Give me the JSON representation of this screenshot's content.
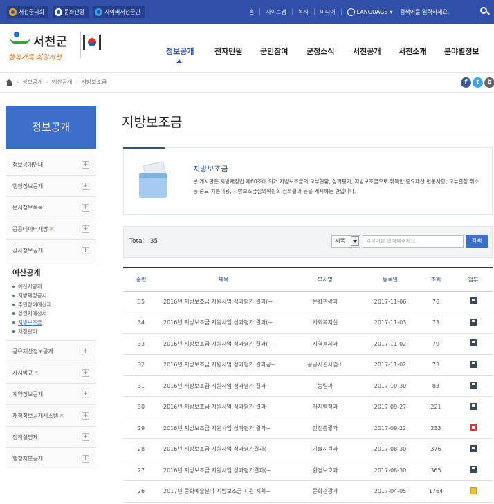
{
  "topbar": {
    "buttons": [
      "서천군의회",
      "문화관광",
      "사이버서천군민"
    ],
    "links": [
      "홈",
      "사이트맵",
      "복지",
      "미디어"
    ],
    "language": "LANGUAGE",
    "search_placeholder": "검색어를 입력하세요."
  },
  "header": {
    "logo_name": "서천군",
    "slogan": "행복가득 희망서천",
    "gnb": [
      "정보공개",
      "전자민원",
      "군민참여",
      "군정소식",
      "서천공개",
      "서천소개",
      "분야별정보"
    ]
  },
  "breadcrumb": [
    "정보공개",
    "예산공개",
    "지방보조금"
  ],
  "sidebar": {
    "title": "정보공개",
    "items_top": [
      {
        "label": "정보공개안내"
      },
      {
        "label": "행정정보공개"
      },
      {
        "label": "문서정보목록"
      },
      {
        "label": "공공데이터개방",
        "mini": "⇱"
      },
      {
        "label": "감사정보공개"
      }
    ],
    "open_group": {
      "label": "예산공개",
      "subs": [
        "예산서공개",
        "지방재정공시",
        "주민참여예산제",
        "성인지예산서",
        "지방보조금",
        "재정관리"
      ],
      "active_index": 4
    },
    "items_bottom": [
      {
        "label": "공유재산정보공개"
      },
      {
        "label": "자치법규",
        "mini": "⇱"
      },
      {
        "label": "계약정보공개"
      },
      {
        "label": "재정정보공개시스템",
        "mini": "⇱"
      },
      {
        "label": "정책실명제"
      },
      {
        "label": "행정처분공개"
      }
    ]
  },
  "main": {
    "page_title": "지방보조금",
    "info": {
      "title": "지방보조금",
      "desc": "본 게시판은 지방재정법 제60조에 의거 지방보조금의 교부현황, 성과평가, 지방보조금으로 취득한 중요재산 변동사항, 교부결정 취소 등 중요 처분내용, 지방보조금심의위원회 심의결과 등을 게시하는 란입니다."
    },
    "total": "Total : 35",
    "search": {
      "select": "제목",
      "placeholder": "검색어를 입력해주세요.",
      "button": "검색"
    },
    "table": {
      "headers": [
        "순번",
        "제목",
        "부서명",
        "등록일",
        "조회",
        "첨부"
      ],
      "rows": [
        {
          "no": "35",
          "title": "2016년 지방보조금 지원사업 성과평가 결과(~",
          "dept": "문화관광과",
          "date": "2017-11-06",
          "views": "76",
          "file": "hwp"
        },
        {
          "no": "34",
          "title": "2016년 지방보조금 지원사업 성과평가 결과(~",
          "dept": "사회복지실",
          "date": "2017-11-03",
          "views": "73",
          "file": "hwp"
        },
        {
          "no": "33",
          "title": "2016년 지방보조금 지원사업 성과평가 결과(~",
          "dept": "지역경제과",
          "date": "2017-11-02",
          "views": "79",
          "file": "hwp"
        },
        {
          "no": "32",
          "title": "2016년 지방보조금 지원사업 성과평가 결과공~",
          "dept": "공공시설사업소",
          "date": "2017-11-02",
          "views": "73",
          "file": "hwp"
        },
        {
          "no": "31",
          "title": "2016년 지방보조금 지원사업 성과평가 결과~",
          "dept": "농림과",
          "date": "2017-10-30",
          "views": "83",
          "file": "hwp"
        },
        {
          "no": "30",
          "title": "2016년 지방보조금 지원사업 성과평가 결과~",
          "dept": "자치행정과",
          "date": "2017-09-27",
          "views": "221",
          "file": "hwp"
        },
        {
          "no": "29",
          "title": "2016년 지방보조금 지원사업 성과평가 결과~",
          "dept": "안전총괄과",
          "date": "2017-09-22",
          "views": "233",
          "file": "pdf"
        },
        {
          "no": "28",
          "title": "2016년 지방보조금 지원사업 성과평가결과(~",
          "dept": "기술지원과",
          "date": "2017-08-30",
          "views": "376",
          "file": "hwp"
        },
        {
          "no": "27",
          "title": "2016년 지방보조금 지원사업 성과평가결과(~",
          "dept": "환경보호과",
          "date": "2017-08-30",
          "views": "365",
          "file": "hwp"
        },
        {
          "no": "26",
          "title": "2017년 문화예술분야 지방보조금 지원 계획~",
          "dept": "문화관광과",
          "date": "2017-04-05",
          "views": "1764",
          "file": "zip"
        }
      ]
    }
  }
}
